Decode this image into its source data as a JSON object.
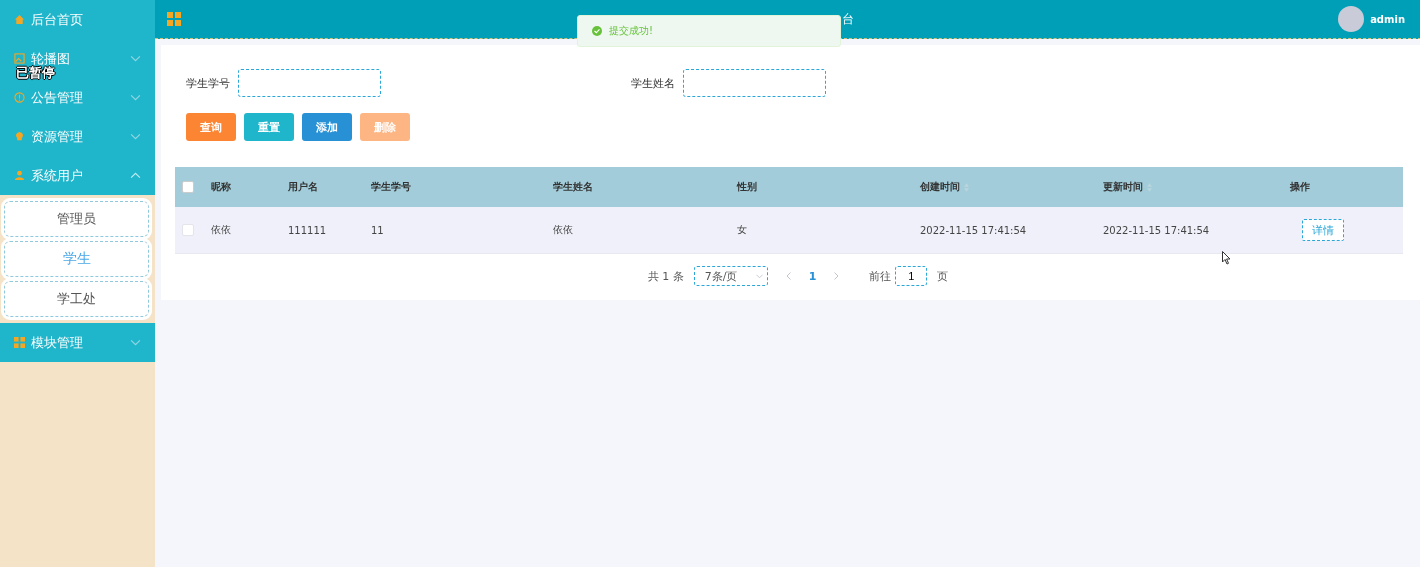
{
  "sidebar": {
    "items": [
      {
        "label": "后台首页"
      },
      {
        "label": "轮播图",
        "expanded": false
      },
      {
        "label": "公告管理",
        "expanded": false
      },
      {
        "label": "资源管理",
        "expanded": false
      },
      {
        "label": "系统用户",
        "expanded": true,
        "children": [
          {
            "label": "管理员",
            "selected": false
          },
          {
            "label": "学生",
            "selected": true
          },
          {
            "label": "学工处",
            "selected": false
          }
        ]
      },
      {
        "label": "模块管理",
        "expanded": false
      }
    ]
  },
  "overlay_label": "已暂停",
  "header": {
    "title": "台",
    "user": "admin"
  },
  "toast": {
    "message": "提交成功!"
  },
  "search": {
    "fields": [
      {
        "label": "学生学号"
      },
      {
        "label": "学生姓名"
      }
    ],
    "buttons": [
      {
        "label": "查询",
        "kind": "query",
        "disabled": false
      },
      {
        "label": "重置",
        "kind": "reset",
        "disabled": false
      },
      {
        "label": "添加",
        "kind": "add",
        "disabled": false
      },
      {
        "label": "删除",
        "kind": "delete",
        "disabled": true
      }
    ]
  },
  "table": {
    "columns": [
      {
        "label": "昵称"
      },
      {
        "label": "用户名"
      },
      {
        "label": "学生学号"
      },
      {
        "label": "学生姓名"
      },
      {
        "label": "性别"
      },
      {
        "label": "创建时间",
        "sortable": true
      },
      {
        "label": "更新时间",
        "sortable": true
      },
      {
        "label": "操作"
      }
    ],
    "all_checked": false,
    "rows": [
      {
        "checked": false,
        "cells": [
          "依依",
          "111111",
          "11",
          "依依",
          "女",
          "2022-11-15 17:41:54",
          "2022-11-15 17:41:54"
        ],
        "action": "详情"
      }
    ]
  },
  "pagination": {
    "total": "共 1 条",
    "page_size": "7条/页",
    "pages": [
      {
        "label": "1",
        "selected": true
      }
    ],
    "goto_label": "前往",
    "goto_value": "1",
    "goto_suffix": "页"
  }
}
